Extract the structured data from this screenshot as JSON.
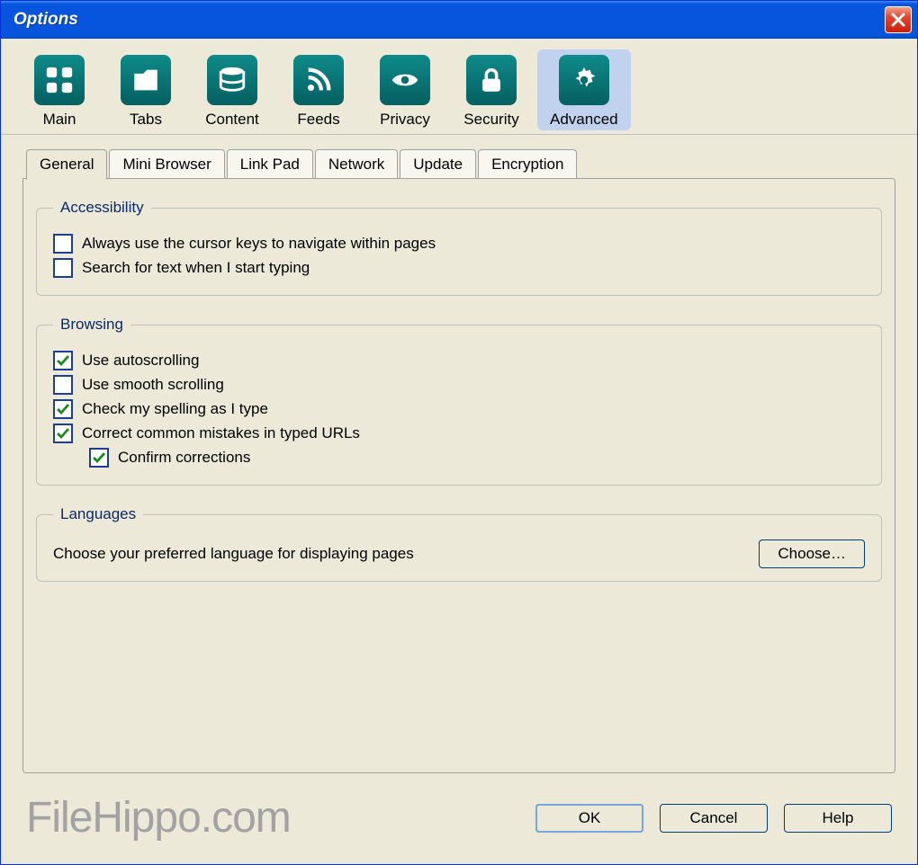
{
  "title": "Options",
  "toolbar": {
    "items": [
      {
        "label": "Main",
        "icon": "grid-icon",
        "selected": false
      },
      {
        "label": "Tabs",
        "icon": "tab-icon",
        "selected": false
      },
      {
        "label": "Content",
        "icon": "stack-icon",
        "selected": false
      },
      {
        "label": "Feeds",
        "icon": "rss-icon",
        "selected": false
      },
      {
        "label": "Privacy",
        "icon": "eye-icon",
        "selected": false
      },
      {
        "label": "Security",
        "icon": "lock-icon",
        "selected": false
      },
      {
        "label": "Advanced",
        "icon": "gear-icon",
        "selected": true
      }
    ]
  },
  "tabs": [
    {
      "label": "General",
      "active": true
    },
    {
      "label": "Mini Browser",
      "active": false
    },
    {
      "label": "Link Pad",
      "active": false
    },
    {
      "label": "Network",
      "active": false
    },
    {
      "label": "Update",
      "active": false
    },
    {
      "label": "Encryption",
      "active": false
    }
  ],
  "groups": {
    "accessibility": {
      "legend": "Accessibility",
      "items": [
        {
          "label": "Always use the cursor keys to navigate within pages",
          "checked": false
        },
        {
          "label": "Search for text when I start typing",
          "checked": false
        }
      ]
    },
    "browsing": {
      "legend": "Browsing",
      "items": [
        {
          "label": "Use autoscrolling",
          "checked": true,
          "indent": false
        },
        {
          "label": "Use smooth scrolling",
          "checked": false,
          "indent": false
        },
        {
          "label": "Check my spelling as I type",
          "checked": true,
          "indent": false
        },
        {
          "label": "Correct common mistakes in typed URLs",
          "checked": true,
          "indent": false
        },
        {
          "label": "Confirm corrections",
          "checked": true,
          "indent": true
        }
      ]
    },
    "languages": {
      "legend": "Languages",
      "text": "Choose your preferred language for displaying pages",
      "button": "Choose…"
    }
  },
  "footer": {
    "brand": "FileHippo.com",
    "ok": "OK",
    "cancel": "Cancel",
    "help": "Help"
  }
}
